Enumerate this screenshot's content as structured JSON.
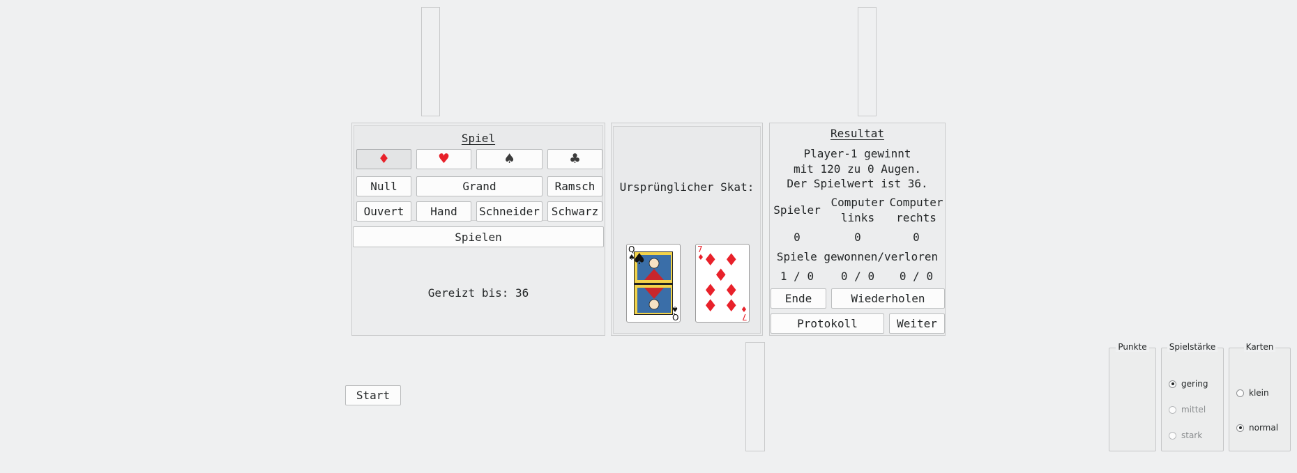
{
  "game_panel": {
    "title": "Spiel",
    "suits": [
      {
        "name": "diamonds",
        "symbol": "♦",
        "color": "#e8212a",
        "pressed": true
      },
      {
        "name": "hearts",
        "symbol": "♥",
        "color": "#e8212a",
        "pressed": false
      },
      {
        "name": "spades",
        "symbol": "♠",
        "color": "#3c3c3c",
        "pressed": false
      },
      {
        "name": "clubs",
        "symbol": "♣",
        "color": "#3c3c3c",
        "pressed": false
      }
    ],
    "null_label": "Null",
    "grand_label": "Grand",
    "ramsch_label": "Ramsch",
    "ouvert_label": "Ouvert",
    "hand_label": "Hand",
    "schneider_label": "Schneider",
    "schwarz_label": "Schwarz",
    "play_label": "Spielen",
    "bid_text": "Gereizt bis: 36"
  },
  "skat_panel": {
    "label": "Ursprünglicher Skat:",
    "cards": [
      {
        "rank": "Q",
        "suit": "♠",
        "suit_name": "spades",
        "color": "#111111"
      },
      {
        "rank": "7",
        "suit": "♦",
        "suit_name": "diamonds",
        "color": "#e8212a"
      }
    ]
  },
  "result_panel": {
    "title": "Resultat",
    "message_line1": "Player-1 gewinnt",
    "message_line2": "mit 120 zu 0 Augen.",
    "message_line3": "Der Spielwert ist 36.",
    "col_player": "Spieler",
    "col_left_1": "Computer",
    "col_left_2": "links",
    "col_right_1": "Computer",
    "col_right_2": "rechts",
    "score_player": "0",
    "score_left": "0",
    "score_right": "0",
    "won_lost_label": "Spiele gewonnen/verloren",
    "wl_player": "1 / 0",
    "wl_left": "0 / 0",
    "wl_right": "0 / 0",
    "end_label": "Ende",
    "repeat_label": "Wiederholen",
    "protocol_label": "Protokoll",
    "next_label": "Weiter"
  },
  "start_label": "Start",
  "options": {
    "points_title": "Punkte",
    "strength_title": "Spielstärke",
    "strength_options": [
      {
        "label": "gering",
        "checked": true,
        "enabled": true
      },
      {
        "label": "mittel",
        "checked": false,
        "enabled": false
      },
      {
        "label": "stark",
        "checked": false,
        "enabled": false
      }
    ],
    "cards_title": "Karten",
    "cards_options": [
      {
        "label": "klein",
        "checked": false
      },
      {
        "label": "normal",
        "checked": true
      }
    ]
  }
}
